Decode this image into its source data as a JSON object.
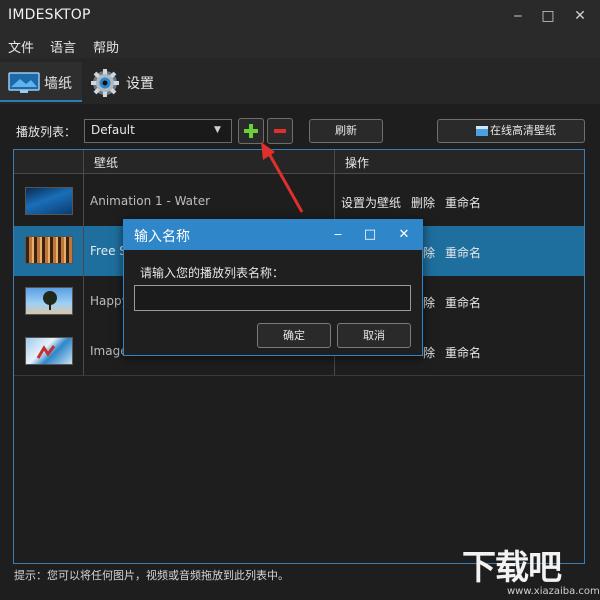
{
  "window": {
    "title": "IMDESKTOP"
  },
  "menu": {
    "items": [
      "文件",
      "语言",
      "帮助"
    ]
  },
  "tabs": [
    {
      "label": "墙纸",
      "icon": "monitor-icon",
      "active": true
    },
    {
      "label": "设置",
      "icon": "gear-icon",
      "active": false
    }
  ],
  "toolbar": {
    "playlist_label": "播放列表：",
    "playlist_selected": "Default",
    "refresh_label": "刷新",
    "online_label": "在线高清壁纸"
  },
  "table": {
    "columns": [
      "壁纸",
      "操作"
    ],
    "rows": [
      {
        "name": "Animation 1 - Water",
        "selected": false
      },
      {
        "name": "Free St",
        "selected": true
      },
      {
        "name": "Happy",
        "selected": false
      },
      {
        "name": "Image",
        "selected": false
      }
    ],
    "actions": {
      "set": "设置为壁纸",
      "delete": "删除",
      "delete_partial": "除",
      "rename": "重命名"
    }
  },
  "dialog": {
    "title": "输入名称",
    "prompt": "请输入您的播放列表名称：",
    "input_value": "",
    "ok_label": "确定",
    "cancel_label": "取消"
  },
  "hint": "提示：您可以将任何图片，视频或音频拖放到此列表中。",
  "watermark": {
    "logo": "下载吧",
    "url": "www.xiazaiba.com"
  },
  "colors": {
    "accent": "#2f86c9",
    "selected_row": "#1f6f9e",
    "add_green": "#6bd03a",
    "remove_red": "#e0302c"
  }
}
